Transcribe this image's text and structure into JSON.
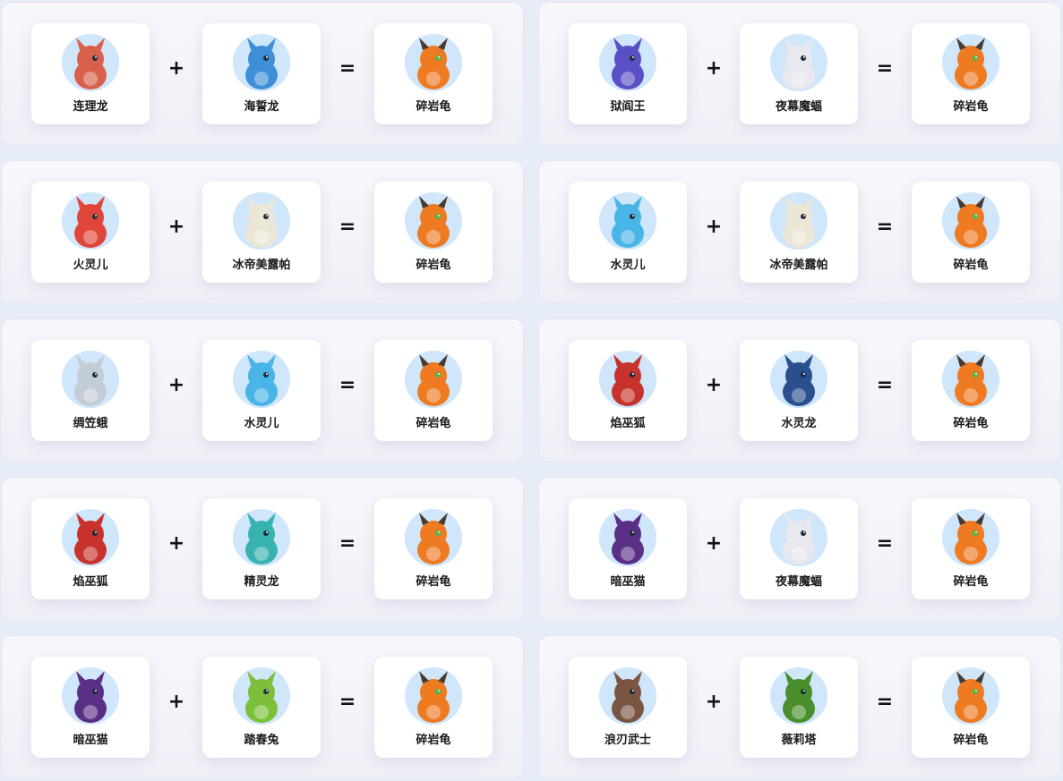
{
  "plus_symbol": "+",
  "equals_symbol": "=",
  "recipes": [
    {
      "parent_a": {
        "name": "连理龙",
        "icon": "lianlilong-portrait-icon",
        "color": "#d9604a"
      },
      "parent_b": {
        "name": "海誓龙",
        "icon": "haishilong-portrait-icon",
        "color": "#3f8fd8"
      },
      "result": {
        "name": "碎岩龟",
        "icon": "suiyangui-portrait-icon",
        "color": "#ee7a22"
      }
    },
    {
      "parent_a": {
        "name": "狱阎王",
        "icon": "yuyanwang-portrait-icon",
        "color": "#5a4fc4"
      },
      "parent_b": {
        "name": "夜幕魔蝠",
        "icon": "yemumofu-portrait-icon",
        "color": "#e8e8ee"
      },
      "result": {
        "name": "碎岩龟",
        "icon": "suiyangui-portrait-icon",
        "color": "#ee7a22"
      }
    },
    {
      "parent_a": {
        "name": "火灵儿",
        "icon": "huolinger-portrait-icon",
        "color": "#e0453a"
      },
      "parent_b": {
        "name": "冰帝美露帕",
        "icon": "bingdimeilupa-portrait-icon",
        "color": "#ece6d6"
      },
      "result": {
        "name": "碎岩龟",
        "icon": "suiyangui-portrait-icon",
        "color": "#ee7a22"
      }
    },
    {
      "parent_a": {
        "name": "水灵儿",
        "icon": "shuilinger-portrait-icon",
        "color": "#49b5e6"
      },
      "parent_b": {
        "name": "冰帝美露帕",
        "icon": "bingdimeilupa-portrait-icon",
        "color": "#ece6d6"
      },
      "result": {
        "name": "碎岩龟",
        "icon": "suiyangui-portrait-icon",
        "color": "#ee7a22"
      }
    },
    {
      "parent_a": {
        "name": "绸笠蛾",
        "icon": "chouli-e-portrait-icon",
        "color": "#c4ccd6"
      },
      "parent_b": {
        "name": "水灵儿",
        "icon": "shuilinger-portrait-icon",
        "color": "#49b5e6"
      },
      "result": {
        "name": "碎岩龟",
        "icon": "suiyangui-portrait-icon",
        "color": "#ee7a22"
      }
    },
    {
      "parent_a": {
        "name": "焰巫狐",
        "icon": "yanwuhu-portrait-icon",
        "color": "#c8322c"
      },
      "parent_b": {
        "name": "水灵龙",
        "icon": "shuilinglong-portrait-icon",
        "color": "#2a4f8e"
      },
      "result": {
        "name": "碎岩龟",
        "icon": "suiyangui-portrait-icon",
        "color": "#ee7a22"
      }
    },
    {
      "parent_a": {
        "name": "焰巫狐",
        "icon": "yanwuhu-portrait-icon",
        "color": "#c8322c"
      },
      "parent_b": {
        "name": "精灵龙",
        "icon": "jinglinglong-portrait-icon",
        "color": "#38b3b0"
      },
      "result": {
        "name": "碎岩龟",
        "icon": "suiyangui-portrait-icon",
        "color": "#ee7a22"
      }
    },
    {
      "parent_a": {
        "name": "暗巫猫",
        "icon": "anwumao-portrait-icon",
        "color": "#5a2f86"
      },
      "parent_b": {
        "name": "夜幕魔蝠",
        "icon": "yemumofu-portrait-icon",
        "color": "#e8e8ee"
      },
      "result": {
        "name": "碎岩龟",
        "icon": "suiyangui-portrait-icon",
        "color": "#ee7a22"
      }
    },
    {
      "parent_a": {
        "name": "暗巫猫",
        "icon": "anwumao-portrait-icon",
        "color": "#5a2f86"
      },
      "parent_b": {
        "name": "踏春兔",
        "icon": "tachuntu-portrait-icon",
        "color": "#7cbf3a"
      },
      "result": {
        "name": "碎岩龟",
        "icon": "suiyangui-portrait-icon",
        "color": "#ee7a22"
      }
    },
    {
      "parent_a": {
        "name": "浪刃武士",
        "icon": "langrenwushi-portrait-icon",
        "color": "#7a5642"
      },
      "parent_b": {
        "name": "薇莉塔",
        "icon": "weilita-portrait-icon",
        "color": "#4a8f2c"
      },
      "result": {
        "name": "碎岩龟",
        "icon": "suiyangui-portrait-icon",
        "color": "#ee7a22"
      }
    }
  ]
}
